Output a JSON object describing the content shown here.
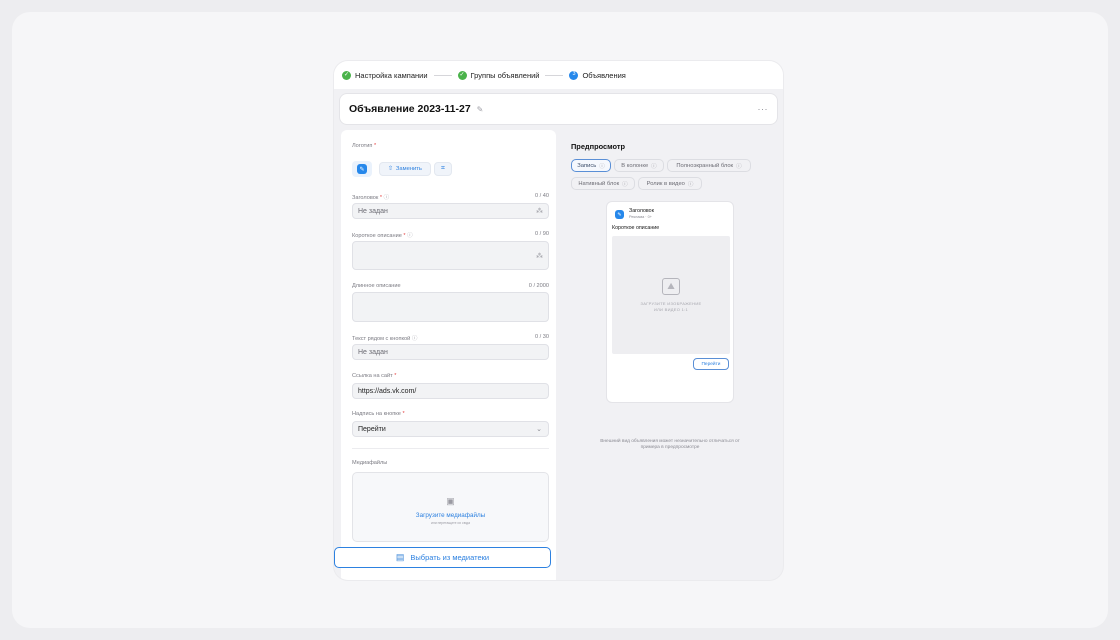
{
  "steps": [
    {
      "label": "Настройка кампании",
      "status": "done"
    },
    {
      "label": "Группы объявлений",
      "status": "done"
    },
    {
      "label": "Объявления",
      "status": "current",
      "number": "3"
    }
  ],
  "header": {
    "title": "Объявление 2023-11-27",
    "more": "···"
  },
  "form": {
    "logo_label": "Логотип",
    "replace_label": "Заменить",
    "headline": {
      "label": "Заголовок",
      "count": "0 / 40",
      "placeholder": "Не задан"
    },
    "short_desc": {
      "label": "Короткое описание",
      "count": "0 / 90",
      "value": ""
    },
    "long_desc": {
      "label": "Длинное описание",
      "count": "0 / 2000",
      "value": ""
    },
    "button_text": {
      "label": "Текст рядом с кнопкой",
      "count": "0 / 30",
      "placeholder": "Не задан"
    },
    "site_link": {
      "label": "Ссылка на сайт",
      "value": "https://ads.vk.com/"
    },
    "button_caption": {
      "label": "Надпись на кнопке",
      "value": "Перейти"
    },
    "media": {
      "label": "Медиафайлы",
      "upload_title": "Загрузите медиафайлы",
      "upload_sub": "или перетащите их сюда"
    },
    "library_button": "Выбрать из медиатеки"
  },
  "preview": {
    "title": "Предпросмотр",
    "tabs": [
      {
        "label": "Запись",
        "active": true
      },
      {
        "label": "В колонке",
        "active": false
      },
      {
        "label": "Полноэкранный блок",
        "active": false
      },
      {
        "label": "Нативный блок",
        "active": false
      },
      {
        "label": "Ролик в видео",
        "active": false
      }
    ],
    "ad": {
      "headline": "Заголовок",
      "sub": "Реклама · 0+",
      "desc": "Короткое описание",
      "media_line1": "ЗАГРУЗИТЕ ИЗОБРАЖЕНИЕ",
      "media_line2": "ИЛИ ВИДЕО 1:1",
      "button": "Перейти"
    },
    "note": "Внешний вид объявления может незначительно отличаться от примера в предпросмотре"
  },
  "colors": {
    "accent": "#2688eb",
    "success": "#4bb34b",
    "required": "#e64646"
  }
}
